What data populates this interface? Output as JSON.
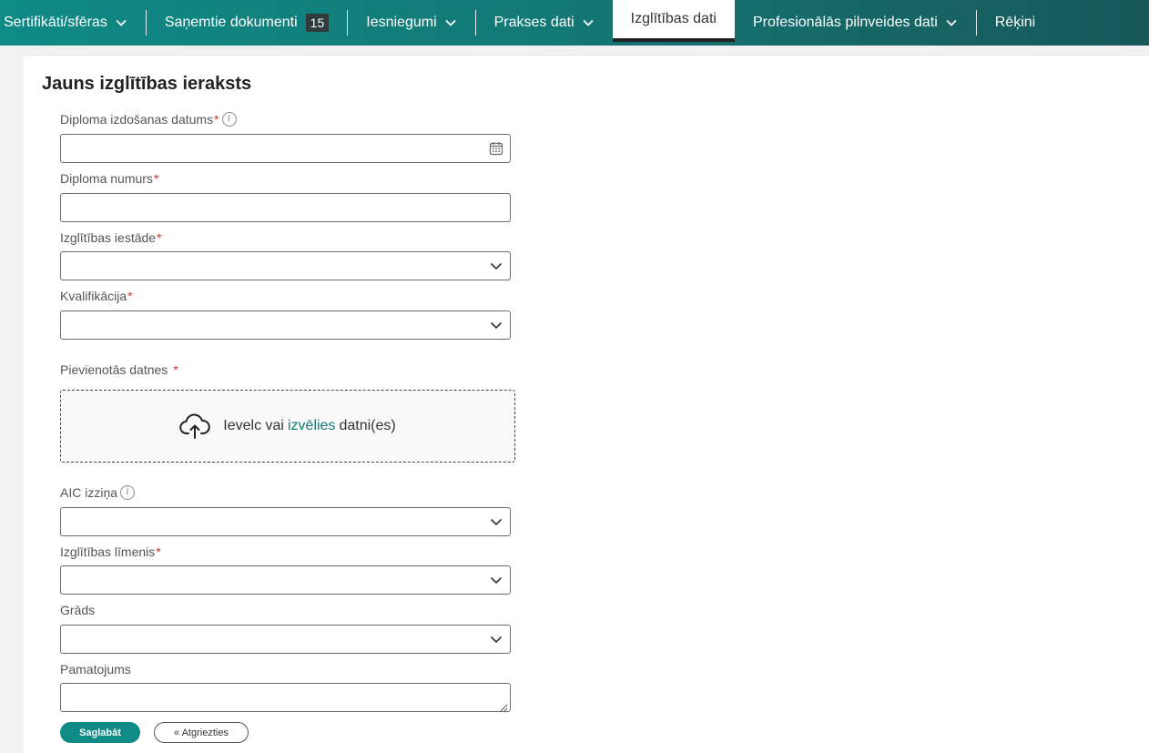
{
  "nav": {
    "items": [
      {
        "label": "Sertifikāti/sfēras"
      },
      {
        "label": "Saņemtie dokumenti",
        "badge": "15"
      },
      {
        "label": "Iesniegumi"
      },
      {
        "label": "Prakses dati"
      },
      {
        "label": "Izglītības dati",
        "active": true
      },
      {
        "label": "Profesionālās pilnveides dati"
      },
      {
        "label": "Rēķini"
      }
    ]
  },
  "form": {
    "title": "Jauns izglītības ieraksts",
    "required_mark": "*",
    "fields": {
      "diploma_date": {
        "label": "Diploma izdošanas datums",
        "value": ""
      },
      "diploma_number": {
        "label": "Diploma numurs",
        "value": ""
      },
      "institution": {
        "label": "Izglītības iestāde",
        "value": ""
      },
      "qualification": {
        "label": "Kvalifikācija",
        "value": ""
      },
      "attachments": {
        "label": "Pievienotās datnes"
      },
      "aic": {
        "label": "AIC izziņa",
        "value": ""
      },
      "edu_level": {
        "label": "Izglītības līmenis",
        "value": ""
      },
      "degree": {
        "label": "Grāds",
        "value": ""
      },
      "justification": {
        "label": "Pamatojums",
        "value": ""
      }
    },
    "dropzone": {
      "prefix": "Ievelc vai",
      "link": "izvēlies",
      "suffix": "datni(es)"
    },
    "info_glyph": "i",
    "buttons": {
      "save": "Saglabāt",
      "back": "« Atgriezties"
    }
  },
  "colors": {
    "accent": "#0f8a86",
    "required": "#c0392b"
  }
}
